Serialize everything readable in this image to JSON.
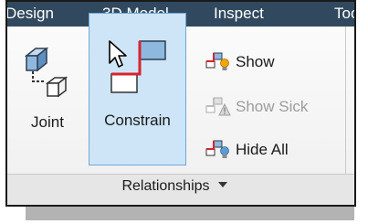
{
  "tabs": {
    "design": "Design",
    "model3d": "3D Model",
    "inspect": "Inspect",
    "tools": "Tools"
  },
  "panel": {
    "title": "Relationships",
    "buttons": {
      "joint": "Joint",
      "constrain": "Constrain",
      "show": "Show",
      "show_sick": "Show Sick",
      "hide_all": "Hide All"
    }
  },
  "state": {
    "hovered_button": "Constrain",
    "disabled_buttons": [
      "Show Sick"
    ]
  },
  "icons": {
    "joint": "joint-icon",
    "constrain": "constrain-icon",
    "show": "show-constraints-icon",
    "show_sick": "show-sick-icon",
    "hide_all": "hide-all-icon",
    "cursor": "mouse-pointer-icon",
    "dropdown": "chevron-down-icon"
  },
  "colors": {
    "tab_bar": "#31495e",
    "hover_fill": "#cde5f6",
    "hover_border": "#6fa9d8",
    "constraint_red": "#d9232e",
    "part_blue": "#8fb8df",
    "bulb_yellow": "#f0a800"
  }
}
